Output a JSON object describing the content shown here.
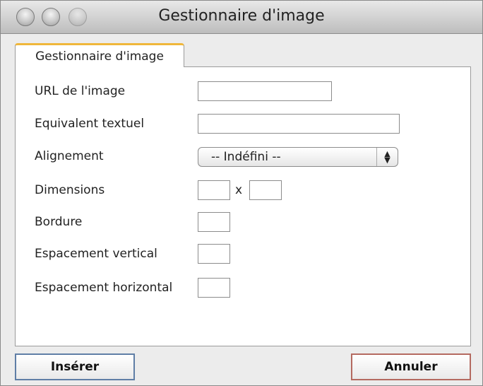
{
  "window": {
    "title": "Gestionnaire d'image"
  },
  "tab": {
    "label": "Gestionnaire d'image"
  },
  "form": {
    "url_label": "URL de l'image",
    "url_value": "",
    "alt_label": "Equivalent textuel",
    "alt_value": "",
    "align_label": "Alignement",
    "align_selected": "-- Indéfini --",
    "dimensions_label": "Dimensions",
    "dimensions_separator": "x",
    "width_value": "",
    "height_value": "",
    "border_label": "Bordure",
    "border_value": "",
    "vspace_label": "Espacement vertical",
    "vspace_value": "",
    "hspace_label": "Espacement horizontal",
    "hspace_value": ""
  },
  "buttons": {
    "insert_label": "Insérer",
    "cancel_label": "Annuler"
  },
  "colors": {
    "tab_accent": "#f0b73b",
    "insert_border": "#5f7ea6",
    "cancel_border": "#b46a60"
  }
}
